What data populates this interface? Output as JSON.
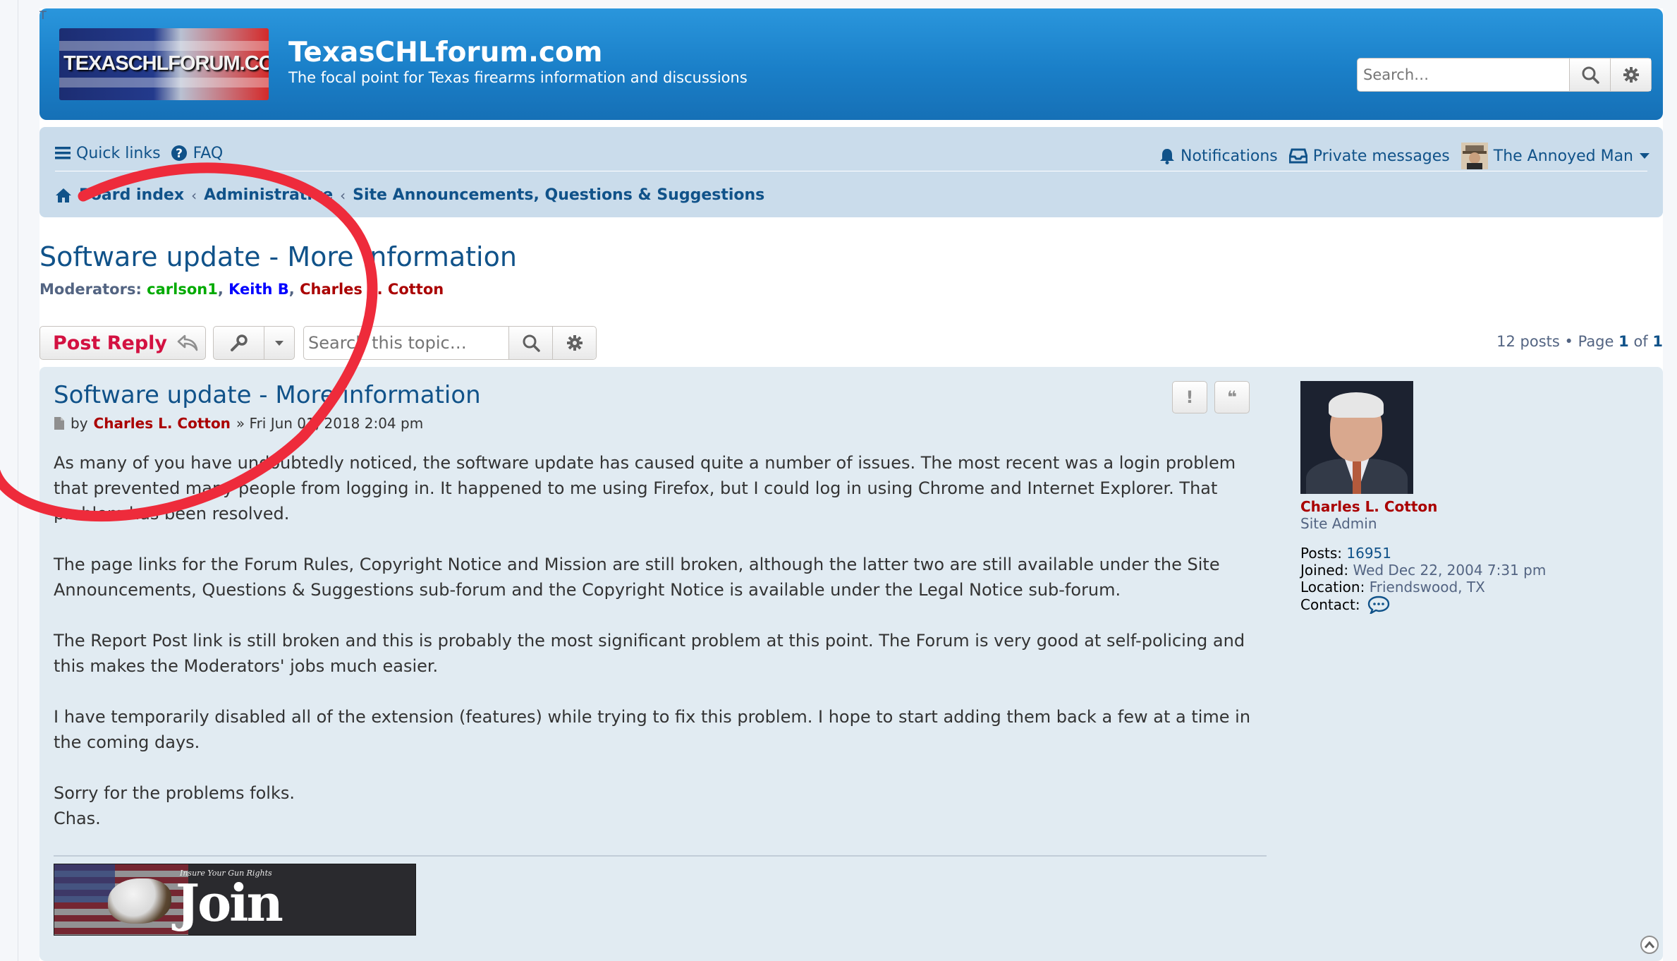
{
  "header": {
    "logo_text": "TEXASCHLFORUM.COM",
    "logo_trail": "T",
    "site_title": "TexasCHLforum.com",
    "site_description": "The focal point for Texas firearms information and discussions",
    "search_placeholder": "Search…"
  },
  "navbar": {
    "quick_links": "Quick links",
    "faq": "FAQ",
    "notifications": "Notifications",
    "private_messages": "Private messages",
    "username": "The Annoyed Man",
    "breadcrumbs": [
      "Board index",
      "Administrative",
      "Site Announcements, Questions & Suggestions"
    ]
  },
  "topic": {
    "title": "Software update - More information",
    "moderators_label": "Moderators:",
    "moderators": [
      "carlson1",
      "Keith B",
      "Charles L. Cotton"
    ],
    "post_reply": "Post Reply",
    "search_placeholder": "Search this topic…",
    "pagination": {
      "posts": "12 posts",
      "page_label": "Page",
      "current": "1",
      "of_label": "of",
      "total": "1"
    }
  },
  "post": {
    "title": "Software update - More information",
    "by_label": "by",
    "author": "Charles L. Cotton",
    "date": "» Fri Jun 01, 2018 2:04 pm",
    "report_icon_label": "!",
    "quote_icon_label": "❝",
    "paragraphs": [
      "As many of you have undoubtedly noticed, the software update has caused quite a number of issues. The most recent was a login problem that prevented many people from logging in. It happened to me using Firefox, but I could log in using Chrome and Internet Explorer. That problem has been resolved.",
      "The page links for the Forum Rules, Copyright Notice and Mission are still broken, although the latter two are still available under the Site Announcements, Questions & Suggestions sub-forum and the Copyright Notice is available under the Legal Notice sub-forum.",
      "The Report Post link is still broken and this is probably the most significant problem at this point. The Forum is very good at self-policing and this makes the Moderators' jobs much easier.",
      "I have temporarily disabled all of the extension (features) while trying to fix this problem. I hope to start adding them back a few at a time in the coming days.",
      "Sorry for the problems folks.",
      "Chas."
    ],
    "signature": {
      "small_text": "Insure Your Gun Rights",
      "main_text": "Join NRA"
    }
  },
  "profile": {
    "name": "Charles L. Cotton",
    "rank": "Site Admin",
    "posts_label": "Posts:",
    "posts_value": "16951",
    "joined_label": "Joined:",
    "joined_value": "Wed Dec 22, 2004 7:31 pm",
    "location_label": "Location:",
    "location_value": "Friendswood, TX",
    "contact_label": "Contact:"
  },
  "colors": {
    "header_blue": "#1a7fc8",
    "navbar_bg": "#cadceb",
    "post_bg": "#e1ebf2",
    "link_blue": "#105289",
    "reply_red": "#d31141",
    "admin_red": "#aa0000",
    "moderator_green": "#00aa00",
    "moderator_blue": "#0000ff",
    "annotation_red": "#ee2b3b"
  }
}
